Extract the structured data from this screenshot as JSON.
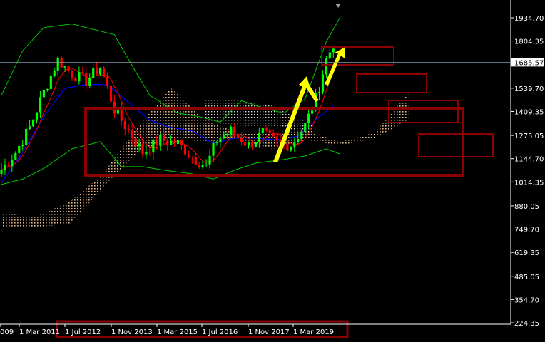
{
  "chart_data": {
    "type": "candlestick",
    "y_axis": {
      "ticks": [
        "1934.70",
        "1804.35",
        "1685.57",
        "1539.70",
        "1409.35",
        "1275.05",
        "1144.70",
        "1014.35",
        "880.05",
        "749.70",
        "619.35",
        "485.05",
        "354.70",
        "224.35"
      ],
      "current_price": "1685.57",
      "ylim": [
        224.35,
        1934.7
      ]
    },
    "x_axis": {
      "ticks": [
        "009",
        "1 Mar 2011",
        "1 Jul 2012",
        "1 Nov 2013",
        "1 Mar 2015",
        "1 Jul 2016",
        "1 Nov 2017",
        "1 Mar 2019"
      ]
    },
    "colors": {
      "background": "#000000",
      "bull": "#00ff00",
      "bear": "#ff0000",
      "kijun": "#0000ff",
      "tenkan": "#ff0000",
      "bollinger": "#00cc00",
      "cloud_a": "#ffcc99",
      "cloud_b": "#f0f0f0",
      "annotation_box": "#8b0000",
      "arrow": "#ffff00",
      "axis_text": "#ffffff"
    }
  }
}
